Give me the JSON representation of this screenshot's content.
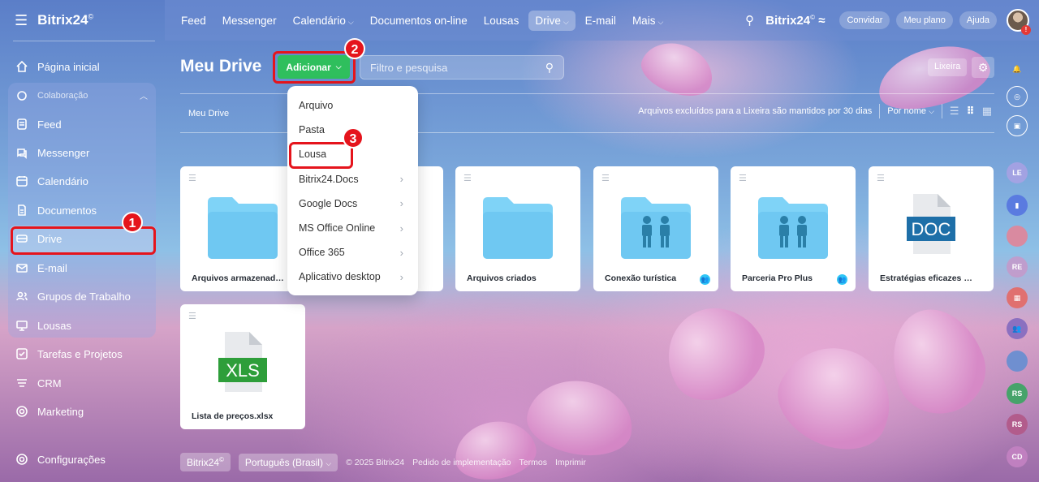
{
  "app": {
    "logo": "Bitrix24",
    "logo_mark": "©"
  },
  "topnav": {
    "items": [
      {
        "label": "Feed",
        "has_chevron": false
      },
      {
        "label": "Messenger",
        "has_chevron": false
      },
      {
        "label": "Calendário",
        "has_chevron": true
      },
      {
        "label": "Documentos on-line",
        "has_chevron": false
      },
      {
        "label": "Lousas",
        "has_chevron": false
      },
      {
        "label": "Drive",
        "has_chevron": true,
        "active": true
      },
      {
        "label": "E-mail",
        "has_chevron": false
      },
      {
        "label": "Mais",
        "has_chevron": true
      }
    ],
    "right": {
      "logo": "Bitrix24",
      "invite": "Convidar",
      "plan": "Meu plano",
      "help": "Ajuda",
      "avatar_alert": "!"
    }
  },
  "sidebar": {
    "home": "Página inicial",
    "group": "Colaboração",
    "items": [
      {
        "label": "Feed",
        "icon": "feed-icon"
      },
      {
        "label": "Messenger",
        "icon": "messenger-icon"
      },
      {
        "label": "Calendário",
        "icon": "calendar-icon"
      },
      {
        "label": "Documentos",
        "icon": "document-icon"
      },
      {
        "label": "Drive",
        "icon": "drive-icon",
        "active": true
      },
      {
        "label": "E-mail",
        "icon": "mail-icon"
      },
      {
        "label": "Grupos de Trabalho",
        "icon": "group-icon"
      },
      {
        "label": "Lousas",
        "icon": "board-icon"
      }
    ],
    "bottom": [
      {
        "label": "Tarefas e Projetos",
        "icon": "tasks-icon"
      },
      {
        "label": "CRM",
        "icon": "crm-icon"
      },
      {
        "label": "Marketing",
        "icon": "marketing-icon"
      }
    ],
    "settings": "Configurações"
  },
  "main": {
    "title": "Meu Drive",
    "add_button": "Adicionar",
    "filter_placeholder": "Filtro e pesquisa",
    "trash": "Lixeira",
    "breadcrumb": "Meu Drive",
    "trash_notice": "Arquivos excluídos para a Lixeira são mantidos por 30 dias",
    "sort": "Por nome"
  },
  "menu": {
    "items": [
      {
        "label": "Arquivo",
        "submenu": false
      },
      {
        "label": "Pasta",
        "submenu": false
      },
      {
        "label": "Lousa",
        "submenu": false
      },
      {
        "label": "Bitrix24.Docs",
        "submenu": true
      },
      {
        "label": "Google Docs",
        "submenu": true
      },
      {
        "label": "MS Office Online",
        "submenu": true
      },
      {
        "label": "Office 365",
        "submenu": true
      },
      {
        "label": "Aplicativo desktop",
        "submenu": true
      }
    ]
  },
  "tiles": [
    {
      "name": "Arquivos armazenados",
      "type": "folder",
      "shared": false
    },
    {
      "name": "",
      "type": "folder",
      "shared": false
    },
    {
      "name": "Arquivos criados",
      "type": "folder",
      "shared": false
    },
    {
      "name": "Conexão turística",
      "type": "shared-folder",
      "shared": true
    },
    {
      "name": "Parceria Pro Plus",
      "type": "shared-folder",
      "shared": true
    },
    {
      "name": "Estratégias eficazes de ma...",
      "type": "doc",
      "badge": "DOC",
      "shared": false
    },
    {
      "name": "Lista de preços.xlsx",
      "type": "xls",
      "badge": "XLS",
      "shared": false
    }
  ],
  "footer": {
    "brand": "Bitrix24",
    "brand_mark": "©",
    "language": "Português (Brasil)",
    "copyright": "© 2025 Bitrix24",
    "links": [
      "Pedido de implementação",
      "Termos",
      "Imprimir"
    ]
  },
  "annotations": [
    "1",
    "2",
    "3"
  ],
  "rail": [
    "LE",
    "RE",
    "RS",
    "RS",
    "CD"
  ],
  "colors": {
    "accent_green": "#2fbf5d",
    "annotation_red": "#e5141c",
    "folder_blue": "#7fd3f7",
    "doc_blue": "#1e6fa8",
    "xls_green": "#2e9e3a"
  }
}
